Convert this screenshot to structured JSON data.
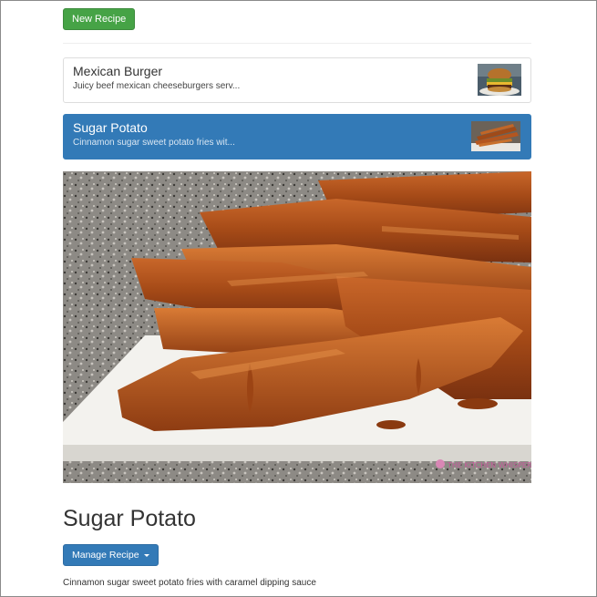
{
  "toolbar": {
    "new_recipe_label": "New Recipe"
  },
  "recipes": [
    {
      "title": "Mexican Burger",
      "snippet": "Juicy beef mexican cheeseburgers serv...",
      "thumbnail": "burger-thumbnail",
      "selected": false
    },
    {
      "title": "Sugar Potato",
      "snippet": "Cinnamon sugar sweet potato fries wit...",
      "thumbnail": "sweet-potato-fries-thumbnail",
      "selected": true
    }
  ],
  "detail": {
    "image": "sweet-potato-fries-photo",
    "image_watermark": "THE KITCHEN WHISPERER",
    "title": "Sugar Potato",
    "manage_label": "Manage Recipe",
    "description": "Cinnamon sugar sweet potato fries with caramel dipping sauce"
  },
  "colors": {
    "success": "#46a346",
    "primary": "#337ab7",
    "border": "#dddddd"
  }
}
